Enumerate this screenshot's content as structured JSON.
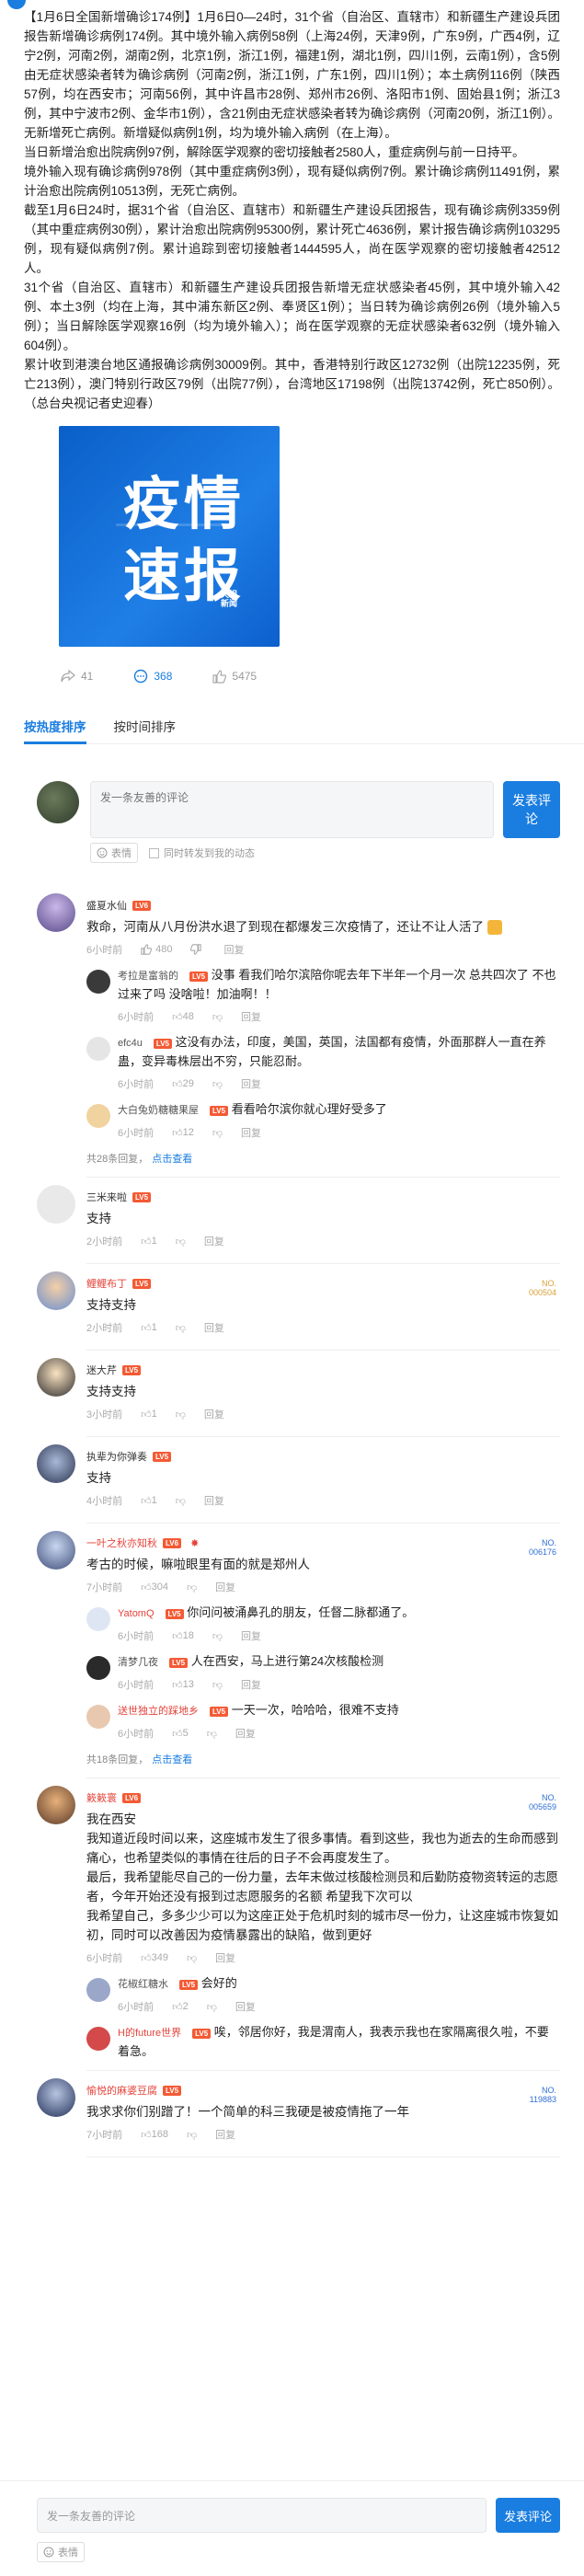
{
  "article": {
    "paragraphs": [
      "【1月6日全国新增确诊174例】1月6日0—24时，31个省（自治区、直辖市）和新疆生产建设兵团报告新增确诊病例174例。其中境外输入病例58例（上海24例，天津9例，广东9例，广西4例，辽宁2例，河南2例，湖南2例，北京1例，浙江1例，福建1例，湖北1例，四川1例，云南1例），含5例由无症状感染者转为确诊病例（河南2例，浙江1例，广东1例，四川1例）；本土病例116例（陕西57例，均在西安市；河南56例，其中许昌市28例、郑州市26例、洛阳市1例、固始县1例；浙江3例，其中宁波市2例、金华市1例），含21例由无症状感染者转为确诊病例（河南20例，浙江1例）。无新增死亡病例。新增疑似病例1例，均为境外输入病例（在上海）。",
      "当日新增治愈出院病例97例，解除医学观察的密切接触者2580人，重症病例与前一日持平。",
      "境外输入现有确诊病例978例（其中重症病例3例），现有疑似病例7例。累计确诊病例11491例，累计治愈出院病例10513例，无死亡病例。",
      "截至1月6日24时，据31个省（自治区、直辖市）和新疆生产建设兵团报告，现有确诊病例3359例（其中重症病例30例），累计治愈出院病例95300例，累计死亡4636例，累计报告确诊病例103295例，现有疑似病例7例。累计追踪到密切接触者1444595人，尚在医学观察的密切接触者42512人。",
      "31个省（自治区、直辖市）和新疆生产建设兵团报告新增无症状感染者45例，其中境外输入42例、本土3例（均在上海，其中浦东新区2例、奉贤区1例）；当日转为确诊病例26例（境外输入5例）；当日解除医学观察16例（均为境外输入）；尚在医学观察的无症状感染者632例（境外输入604例）。",
      "累计收到港澳台地区通报确诊病例30009例。其中，香港特别行政区12732例（出院12235例，死亡213例），澳门特别行政区79例（出院77例），台湾地区17198例（出院13742例，死亡850例）。（总台央视记者史迎春）"
    ],
    "cover": {
      "line1": "疫情",
      "line2": "速报",
      "brand": "央视新闻"
    }
  },
  "stats": {
    "forward": "41",
    "comments": "368",
    "likes": "5475"
  },
  "tabs": {
    "hot": "按热度排序",
    "time": "按时间排序"
  },
  "composer": {
    "placeholder": "发一条友善的评论",
    "send": "发表评论",
    "emoji": "表情",
    "sync": "同时转发到我的动态"
  },
  "comments": [
    {
      "name": "盛夏水仙",
      "text": "救命，河南从八月份洪水退了到现在都爆发三次疫情了，还让不让人活了",
      "time": "6小时前",
      "likes": "480",
      "reply": "回复",
      "replies": [
        {
          "name": "考拉是富翁的",
          "text": "没事 看我们哈尔滨陪你呢去年下半年一个月一次 总共四次了 不也过来了吗 没啥啦！加油啊！！",
          "time": "6小时前",
          "likes": "48"
        },
        {
          "name": "efc4u",
          "text": "这没有办法，印度，美国，英国，法国都有疫情，外面那群人一直在养蛊，变异毒株层出不穷，只能忍耐。",
          "time": "6小时前",
          "likes": "29"
        },
        {
          "name": "大白兔奶糖糖果屋",
          "text": "看看哈尔滨你就心理好受多了",
          "time": "6小时前",
          "likes": "12"
        }
      ],
      "more_count": "共28条回复，",
      "more_link": "点击查看"
    },
    {
      "name": "三米来啦",
      "text": "支持",
      "time": "2小时前",
      "likes": "1",
      "reply": "回复"
    },
    {
      "name": "鲤鲤布丁",
      "text": "支持支持",
      "time": "2小时前",
      "likes": "1",
      "reply": "回复",
      "badge": "NO.\n000504"
    },
    {
      "name": "迷大芹",
      "text": "支持支持",
      "time": "3小时前",
      "likes": "1",
      "reply": "回复"
    },
    {
      "name": "执辈为你弹奏",
      "text": "支持",
      "time": "4小时前",
      "likes": "1",
      "reply": "回复"
    },
    {
      "name": "一叶之秋亦知秋",
      "text": "考古的时候，嘛啦眼里有面的就是郑州人",
      "time": "7小时前",
      "likes": "304",
      "reply": "回复",
      "badge": "NO.\n006176",
      "replies": [
        {
          "name": "YatomQ",
          "text": "你问问被涌鼻孔的朋友，任督二脉都通了。",
          "time": "6小时前",
          "likes": "18"
        },
        {
          "name": "清梦几夜",
          "text": "人在西安，马上进行第24次核酸检测",
          "time": "6小时前",
          "likes": "13"
        },
        {
          "name": "送世独立的踩地乡",
          "text": "一天一次，哈哈哈，很难不支持",
          "time": "6小时前",
          "likes": "5"
        }
      ],
      "more_count": "共18条回复，",
      "more_link": "点击查看"
    },
    {
      "name": "簌簌寰",
      "text": "我在西安\n我知道近段时间以来，这座城市发生了很多事情。看到这些，我也为逝去的生命而感到痛心，也希望类似的事情在往后的日子不会再度发生了。\n最后，我希望能尽自己的一份力量，去年末做过核酸检测员和后勤防疫物资转运的志愿者，今年开始还没有报到过志愿服务的名额 希望我下次可以\n我希望自己，多多少少可以为这座正处于危机时刻的城市尽一份力，让这座城市恢复如初，同时可以改善因为疫情暴露出的缺陷，做到更好",
      "time": "6小时前",
      "likes": "349",
      "reply": "回复",
      "badge": "NO.\n005659",
      "replies": [
        {
          "name": "花椒红糖水",
          "text": "会好的",
          "time": "6小时前",
          "likes": "2"
        },
        {
          "name": "H的future世界",
          "text": "唉，邻居你好，我是渭南人，我表示我也在家隔离很久啦，不要着急。",
          "time": "",
          "likes": ""
        }
      ]
    },
    {
      "name": "愉悦的麻婆豆腐",
      "text": "我求求你们别蹭了！一个简单的科三我硬是被疫情拖了一年",
      "time": "7小时前",
      "likes": "168",
      "reply": "回复",
      "badge": "NO.\n119883"
    }
  ],
  "bottom": {
    "placeholder": "发一条友善的评论",
    "send": "发表评论",
    "emoji": "表情"
  }
}
